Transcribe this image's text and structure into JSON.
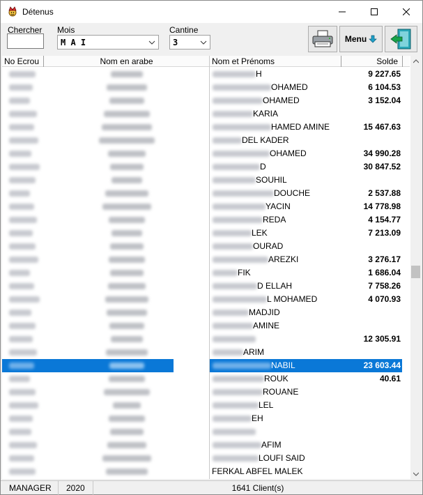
{
  "window": {
    "title": "Détenus"
  },
  "toolbar": {
    "search_label": "Chercher",
    "search_value": "",
    "mois_label": "Mois",
    "mois_value": "M A I",
    "cantine_label": "Cantine",
    "cantine_value": "3",
    "menu_label": "Menu"
  },
  "icons": {
    "app": "jester-icon",
    "printer": "printer-icon",
    "menu_arrow": "arrow-down-icon",
    "exit": "exit-door-icon"
  },
  "table": {
    "columns": [
      "No Ecrou",
      "Nom en arabe",
      "Nom et Prénoms",
      "Solde"
    ],
    "rows": [
      {
        "nom": "H",
        "solde": "9 227.65"
      },
      {
        "nom": "OHAMED",
        "solde": "6 104.53"
      },
      {
        "nom": "OHAMED",
        "solde": "3 152.04"
      },
      {
        "nom": "KARIA",
        "solde": ""
      },
      {
        "nom": "HAMED AMINE",
        "solde": "15 467.63"
      },
      {
        "nom": "DEL KADER",
        "solde": ""
      },
      {
        "nom": "OHAMED",
        "solde": "34 990.28"
      },
      {
        "nom": "D",
        "solde": "30 847.52"
      },
      {
        "nom": "SOUHIL",
        "solde": ""
      },
      {
        "nom": "DOUCHE",
        "solde": "2 537.88"
      },
      {
        "nom": "YACIN",
        "solde": "14 778.98"
      },
      {
        "nom": "REDA",
        "solde": "4 154.77"
      },
      {
        "nom": "LEK",
        "solde": "7 213.09"
      },
      {
        "nom": "OURAD",
        "solde": ""
      },
      {
        "nom": "AREZKI",
        "solde": "3 276.17"
      },
      {
        "nom": "FIK",
        "solde": "1 686.04"
      },
      {
        "nom": "D ELLAH",
        "solde": "7 758.26"
      },
      {
        "nom": "L MOHAMED",
        "solde": "4 070.93"
      },
      {
        "nom": "MADJID",
        "solde": ""
      },
      {
        "nom": "AMINE",
        "solde": ""
      },
      {
        "nom": "",
        "solde": "12 305.91"
      },
      {
        "nom": "ARIM",
        "solde": ""
      },
      {
        "nom": "NABIL",
        "solde": "23 603.44",
        "selected": true
      },
      {
        "nom": "ROUK",
        "solde": "40.61"
      },
      {
        "nom": "ROUANE",
        "solde": ""
      },
      {
        "nom": "LEL",
        "solde": ""
      },
      {
        "nom": "EH",
        "solde": ""
      },
      {
        "nom": "",
        "solde": ""
      },
      {
        "nom": "AFIM",
        "solde": ""
      },
      {
        "nom": "LOUFI SAID",
        "solde": ""
      },
      {
        "nom": "FERKAL ABFEL MALEK",
        "solde": ""
      }
    ]
  },
  "status": {
    "user": "MANAGER",
    "year": "2020",
    "count": "1641 Client(s)"
  }
}
